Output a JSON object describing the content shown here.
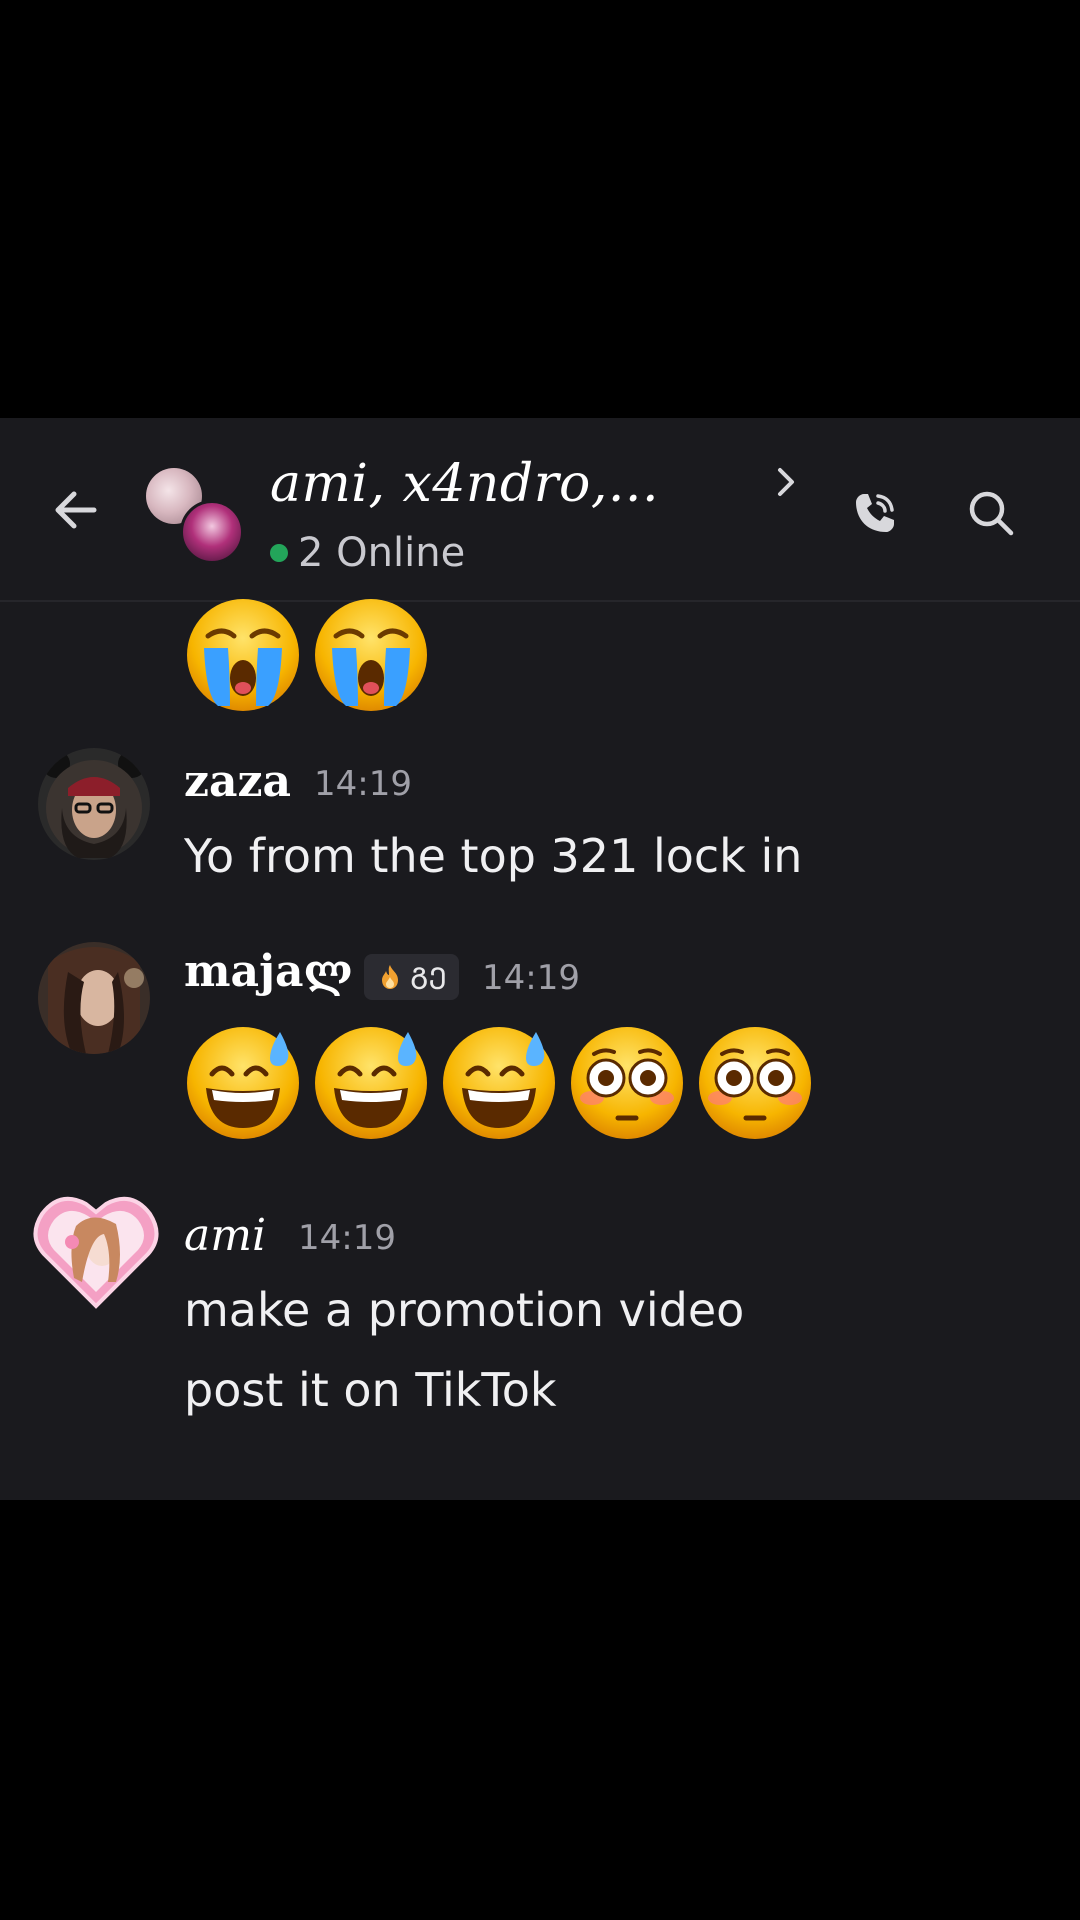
{
  "header": {
    "title": "ami, x4ndro,...",
    "online_status": "2 Online"
  },
  "colors": {
    "online_dot": "#23a55a",
    "background": "#1a1a1e"
  },
  "icons": {
    "back": "arrow-left-icon",
    "call": "phone-icon",
    "search": "search-icon",
    "chevron": "chevron-right-icon"
  },
  "messages": [
    {
      "content_emojis": [
        "loudly-crying-face",
        "loudly-crying-face"
      ]
    },
    {
      "username": "zaza",
      "time": "14:19",
      "text": "Yo from the top 321 lock in"
    },
    {
      "username": "majaლ",
      "tag": "ᲒᲔ",
      "time": "14:19",
      "content_emojis": [
        "grinning-face-with-sweat",
        "grinning-face-with-sweat",
        "grinning-face-with-sweat",
        "flushed-face",
        "flushed-face"
      ]
    },
    {
      "username": "ami",
      "time": "14:19",
      "text_lines": [
        "make a promotion video",
        "post it on TikTok"
      ]
    }
  ]
}
